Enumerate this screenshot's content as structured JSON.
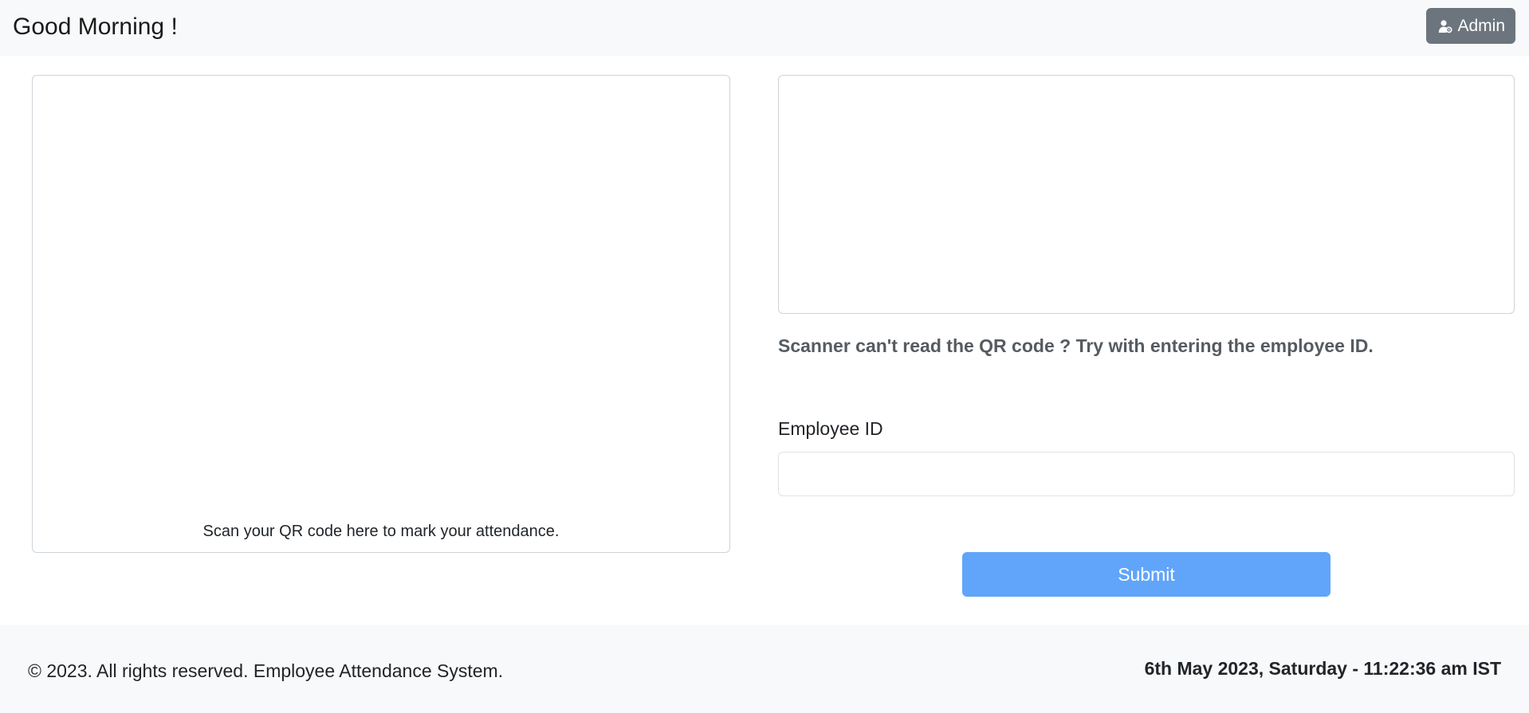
{
  "header": {
    "greeting": "Good Morning !",
    "admin_button_label": "Admin",
    "admin_icon": "user-gear-icon"
  },
  "scanner": {
    "caption": "Scan your QR code here to mark your attendance."
  },
  "manual_entry": {
    "hint": "Scanner can't read the QR code ? Try with entering the employee ID.",
    "employee_id_label": "Employee ID",
    "employee_id_value": "",
    "submit_label": "Submit"
  },
  "footer": {
    "copyright": "© 2023. All rights reserved. Employee Attendance System.",
    "datetime": "6th May 2023, Saturday - 11:22:36 am IST"
  },
  "colors": {
    "topbar_bg": "#f8f9fa",
    "admin_button_bg": "#6c757d",
    "submit_button_bg": "#60a5fa",
    "border": "#ced4da"
  }
}
